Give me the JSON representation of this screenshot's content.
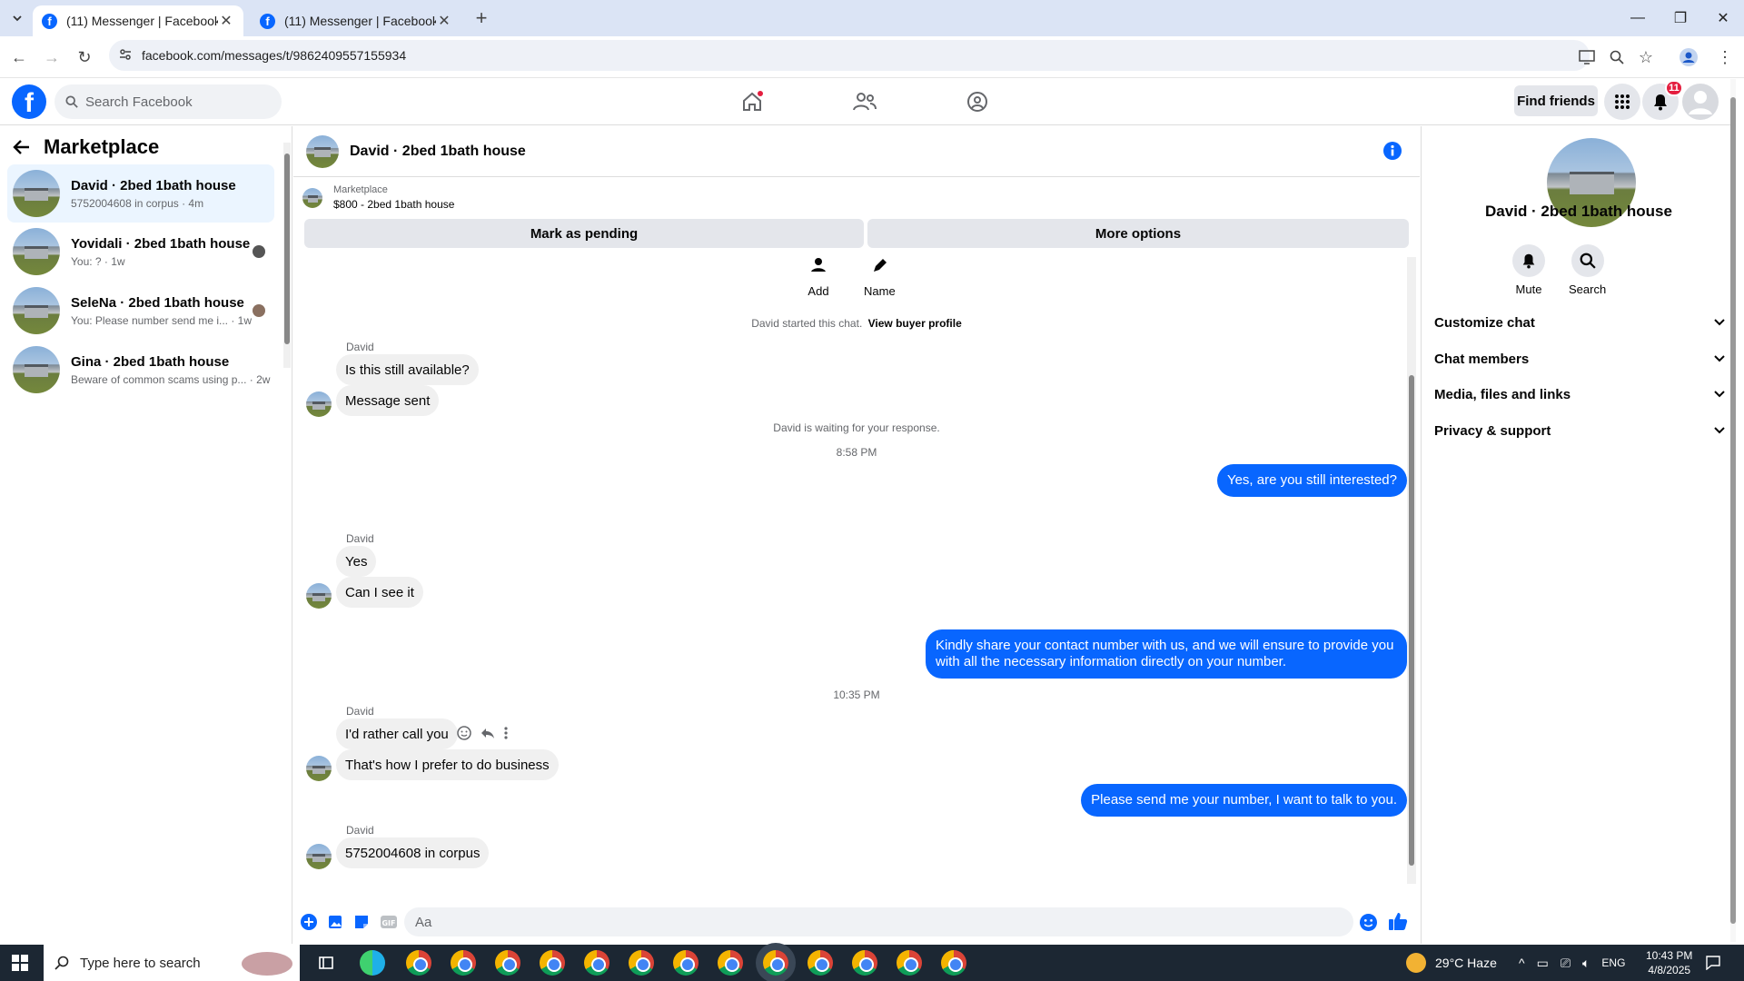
{
  "browser": {
    "tabs": [
      {
        "title": "(11) Messenger | Facebook"
      },
      {
        "title": "(11) Messenger | Facebook"
      }
    ],
    "url": "facebook.com/messages/t/9862409557155934"
  },
  "topbar": {
    "search_placeholder": "Search Facebook",
    "find_friends": "Find friends",
    "notification_count": "11",
    "brand_color": "#0866ff"
  },
  "left": {
    "title": "Marketplace",
    "conversations": [
      {
        "name": "David · 2bed 1bath house",
        "sub": "5752004608 in corpus · 4m"
      },
      {
        "name": "Yovidali · 2bed 1bath house",
        "sub": "You: ? · 1w"
      },
      {
        "name": "SeleNa · 2bed 1bath house",
        "sub": "You: Please number send me i... · 1w"
      },
      {
        "name": "Gina · 2bed 1bath house",
        "sub": "Beware of common scams using p... · 2w"
      }
    ]
  },
  "chat": {
    "title": "David · 2bed 1bath house",
    "listing_source": "Marketplace",
    "listing_line": "$800 - 2bed 1bath house",
    "mark_pending": "Mark as pending",
    "more_options": "More options",
    "quick_actions": {
      "add": "Add",
      "name": "Name"
    },
    "started_text": "David started this chat.",
    "view_profile": "View buyer profile",
    "sender": "David",
    "m1": "Is this still available?",
    "m2": "Message sent",
    "waiting": "David is waiting for your response.",
    "time1": "8:58 PM",
    "out1": "Yes, are you still interested?",
    "m3": "Yes",
    "m4": "Can I see it",
    "out2": "Kindly share your contact number with us, and we will ensure to provide you with all the necessary information directly on your number.",
    "time2": "10:35 PM",
    "m5": "I'd rather call you",
    "m6": "That's how I prefer to do business",
    "out3": "Please send me your number, I want to talk to you.",
    "m7": "5752004608 in corpus",
    "compose_placeholder": "Aa"
  },
  "right": {
    "name": "David · 2bed 1bath house",
    "mute": "Mute",
    "search": "Search",
    "sections": [
      "Customize chat",
      "Chat members",
      "Media, files and links",
      "Privacy & support"
    ]
  },
  "taskbar": {
    "search": "Type here to search",
    "weather": "29°C  Haze",
    "lang": "ENG",
    "time": "10:43 PM",
    "date": "4/8/2025"
  }
}
